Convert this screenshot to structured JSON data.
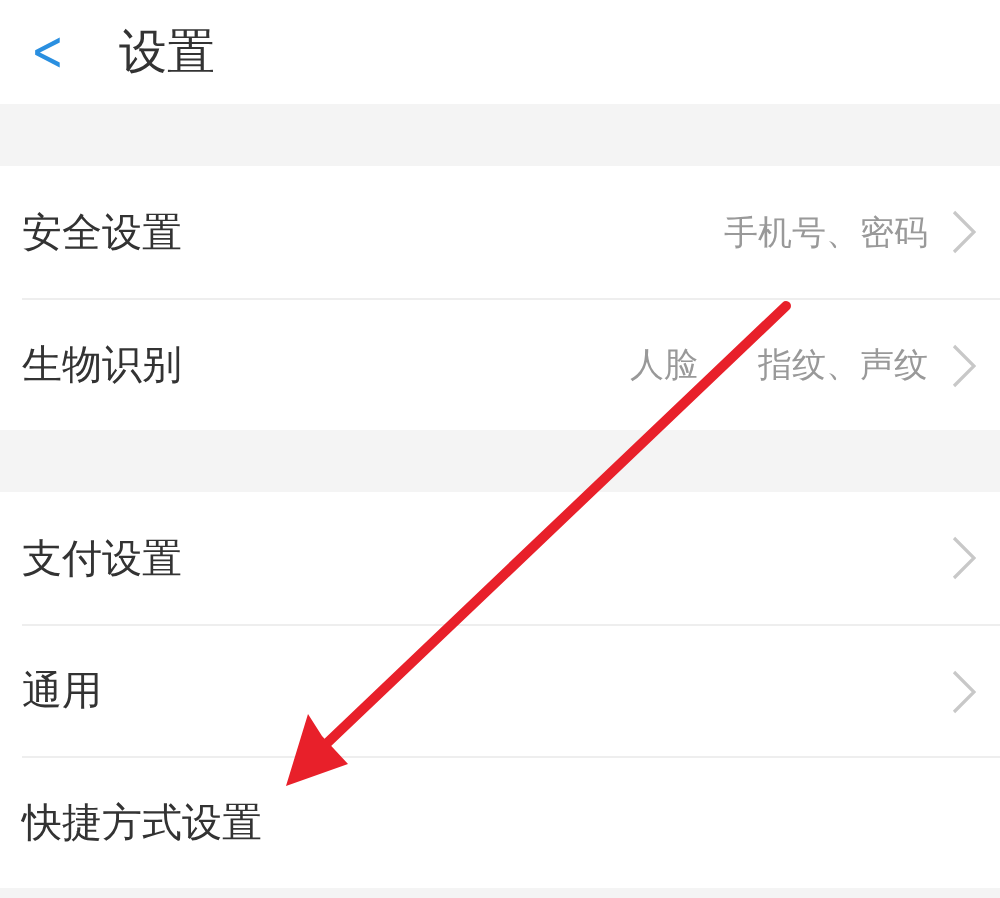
{
  "header": {
    "back": "<",
    "title": "设置"
  },
  "groups": [
    {
      "rows": [
        {
          "label": "安全设置",
          "value": [
            "手机号、密码"
          ],
          "chevron": true
        },
        {
          "label": "生物识别",
          "value": [
            "人脸",
            "指纹、声纹"
          ],
          "chevron": true
        }
      ]
    },
    {
      "rows": [
        {
          "label": "支付设置",
          "chevron": true
        },
        {
          "label": "通用",
          "chevron": true
        },
        {
          "label": "快捷方式设置",
          "chevron": false
        }
      ]
    }
  ],
  "annotation": {
    "kind": "arrow"
  }
}
